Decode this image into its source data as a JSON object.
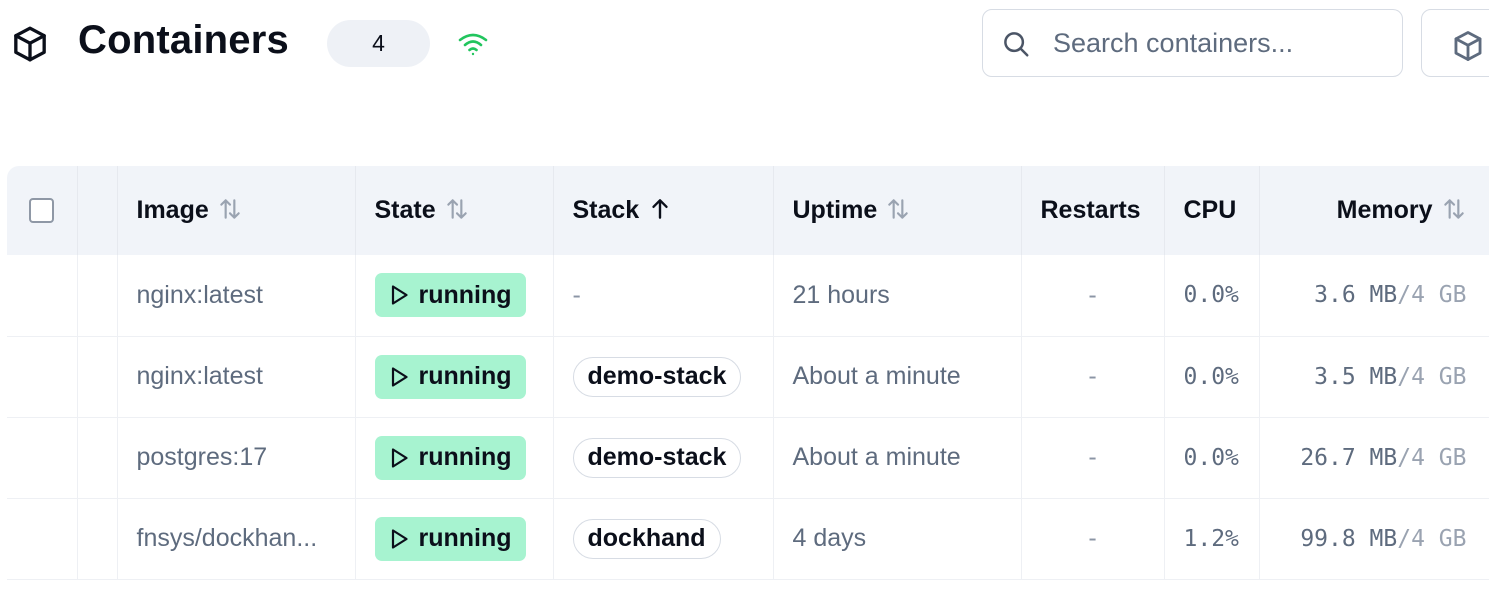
{
  "header": {
    "title": "Containers",
    "count": "4",
    "search_placeholder": "Search containers...",
    "connection_color": "#22c55e"
  },
  "table": {
    "columns": {
      "image": "Image",
      "state": "State",
      "stack": "Stack",
      "uptime": "Uptime",
      "restarts": "Restarts",
      "cpu": "CPU",
      "memory": "Memory"
    },
    "sort": {
      "column": "stack",
      "direction": "ascending"
    },
    "rows": [
      {
        "image": "nginx:latest",
        "state": "running",
        "stack": "-",
        "uptime": "21 hours",
        "restarts": "-",
        "cpu": "0.0%",
        "mem_used": "3.6 MB",
        "mem_total": "/4 GB"
      },
      {
        "image": "nginx:latest",
        "state": "running",
        "stack": "demo-stack",
        "uptime": "About a minute",
        "restarts": "-",
        "cpu": "0.0%",
        "mem_used": "3.5 MB",
        "mem_total": "/4 GB"
      },
      {
        "image": "postgres:17",
        "state": "running",
        "stack": "demo-stack",
        "uptime": "About a minute",
        "restarts": "-",
        "cpu": "0.0%",
        "mem_used": "26.7 MB",
        "mem_total": "/4 GB"
      },
      {
        "image": "fnsys/dockhan...",
        "state": "running",
        "stack": "dockhand",
        "uptime": "4 days",
        "restarts": "-",
        "cpu": "1.2%",
        "mem_used": "99.8 MB",
        "mem_total": "/4 GB"
      }
    ]
  },
  "colors": {
    "running_bg": "#a7f3d0",
    "header_bg": "#f1f4f9",
    "muted_text": "#5e6b7e"
  },
  "icons": {
    "title": "cube-icon",
    "connection": "wifi-icon",
    "search": "search-icon",
    "toolbar": "cube-icon",
    "state": "play-icon",
    "sort_neutral": "sort-arrows-icon",
    "sort_active": "arrow-up-icon"
  }
}
